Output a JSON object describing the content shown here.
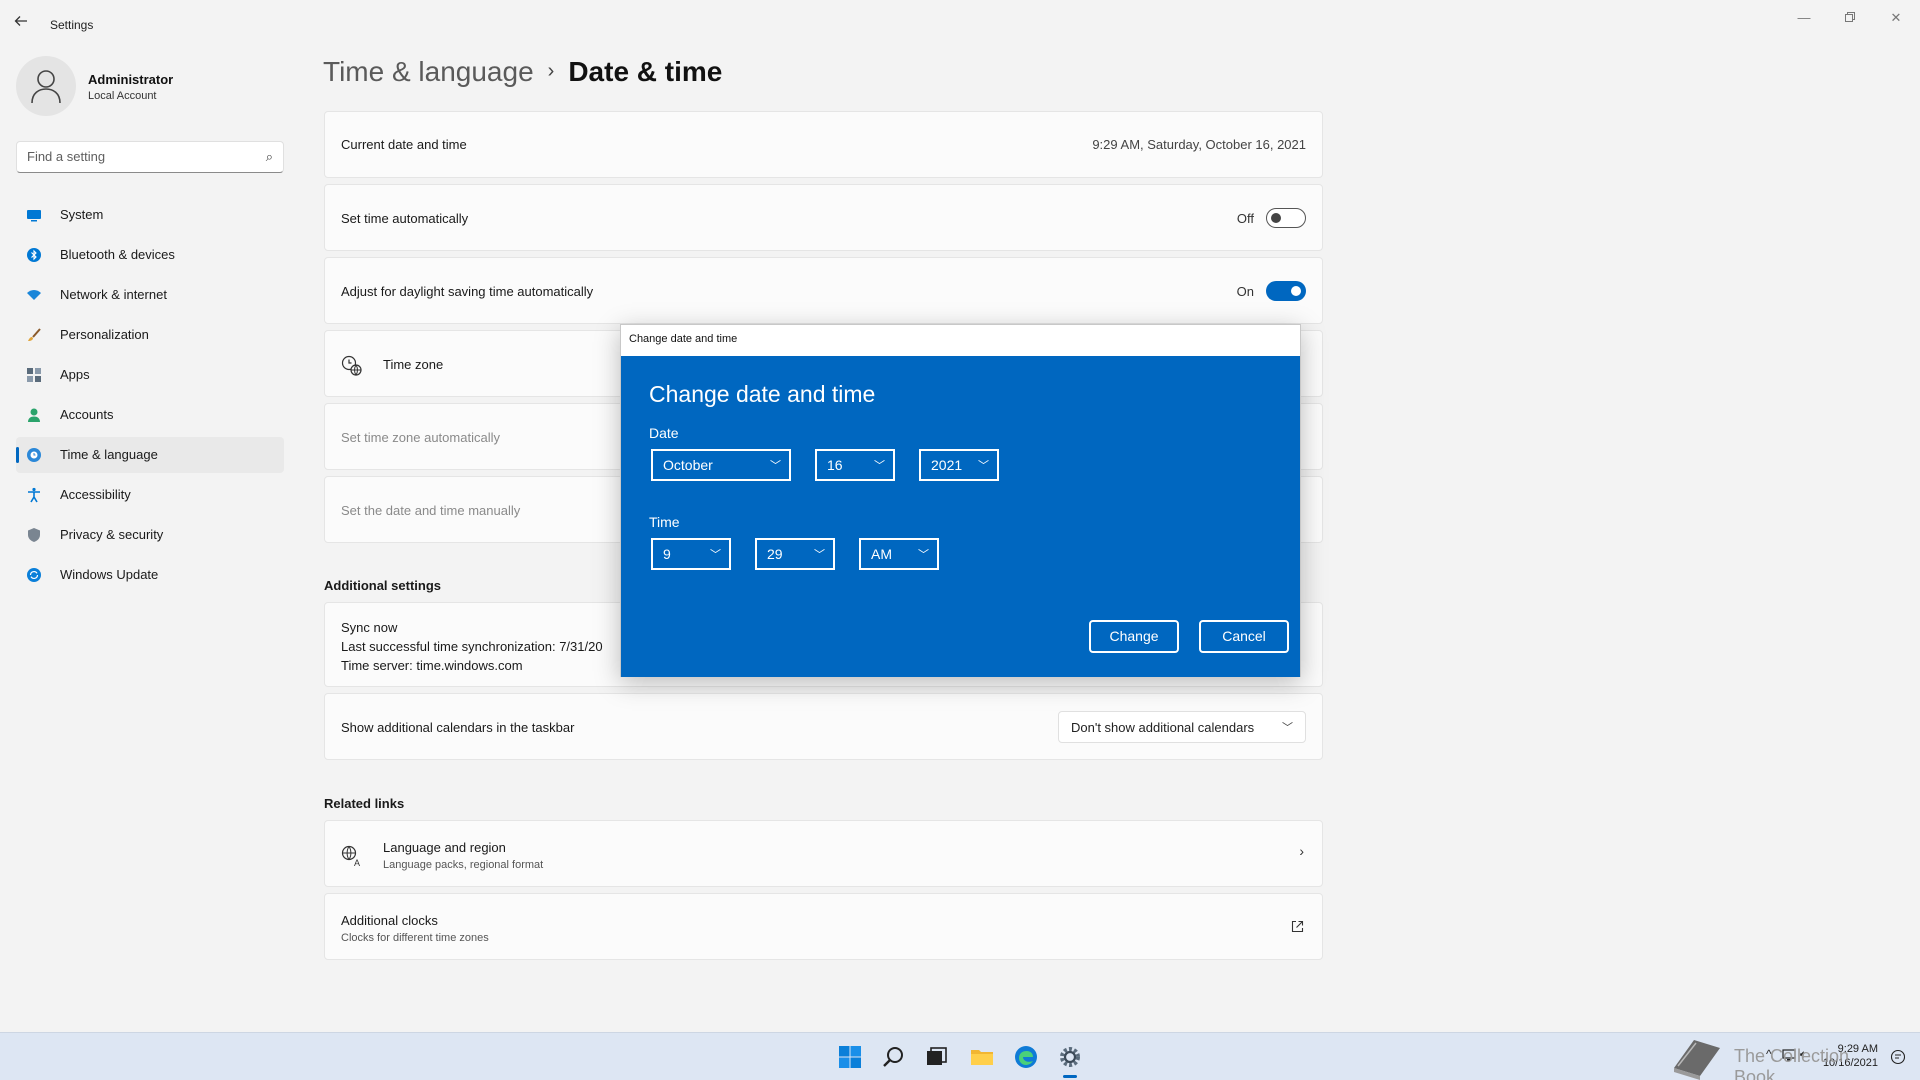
{
  "window": {
    "title": "Settings"
  },
  "profile": {
    "name": "Administrator",
    "account_type": "Local Account"
  },
  "search": {
    "placeholder": "Find a setting"
  },
  "sidebar": {
    "items": [
      {
        "label": "System",
        "icon": "system-icon"
      },
      {
        "label": "Bluetooth & devices",
        "icon": "bluetooth-icon"
      },
      {
        "label": "Network & internet",
        "icon": "wifi-icon"
      },
      {
        "label": "Personalization",
        "icon": "brush-icon"
      },
      {
        "label": "Apps",
        "icon": "apps-icon"
      },
      {
        "label": "Accounts",
        "icon": "accounts-icon"
      },
      {
        "label": "Time & language",
        "icon": "globe-clock-icon",
        "active": true
      },
      {
        "label": "Accessibility",
        "icon": "accessibility-icon"
      },
      {
        "label": "Privacy & security",
        "icon": "shield-icon"
      },
      {
        "label": "Windows Update",
        "icon": "update-icon"
      }
    ]
  },
  "breadcrumb": {
    "parent": "Time & language",
    "separator": "›",
    "current": "Date & time"
  },
  "settings": {
    "current": {
      "label": "Current date and time",
      "value": "9:29 AM, Saturday, October 16, 2021"
    },
    "set_auto": {
      "label": "Set time automatically",
      "state": "Off"
    },
    "dst": {
      "label": "Adjust for daylight saving time automatically",
      "state": "On"
    },
    "timezone": {
      "label": "Time zone"
    },
    "tz_auto": {
      "label": "Set time zone automatically"
    },
    "manual": {
      "label": "Set the date and time manually"
    }
  },
  "additional": {
    "heading": "Additional settings",
    "sync": {
      "label": "Sync now",
      "line1": "Last successful time synchronization: 7/31/20",
      "line2": "Time server: time.windows.com"
    },
    "calendars": {
      "label": "Show additional calendars in the taskbar",
      "value": "Don't show additional calendars"
    }
  },
  "related": {
    "heading": "Related links",
    "language": {
      "label": "Language and region",
      "sub": "Language packs, regional format"
    },
    "clocks": {
      "label": "Additional clocks",
      "sub": "Clocks for different time zones"
    }
  },
  "dialog": {
    "caption": "Change date and time",
    "title": "Change date and time",
    "date_label": "Date",
    "month": "October",
    "day": "16",
    "year": "2021",
    "time_label": "Time",
    "hour": "9",
    "minute": "29",
    "ampm": "AM",
    "change_label": "Change",
    "cancel_label": "Cancel"
  },
  "taskbar": {
    "time": "9:29 AM",
    "date": "10/16/2021",
    "watermark": "The Collection Book"
  },
  "colors": {
    "accent": "#0067c0",
    "background": "#f3f3f3"
  }
}
